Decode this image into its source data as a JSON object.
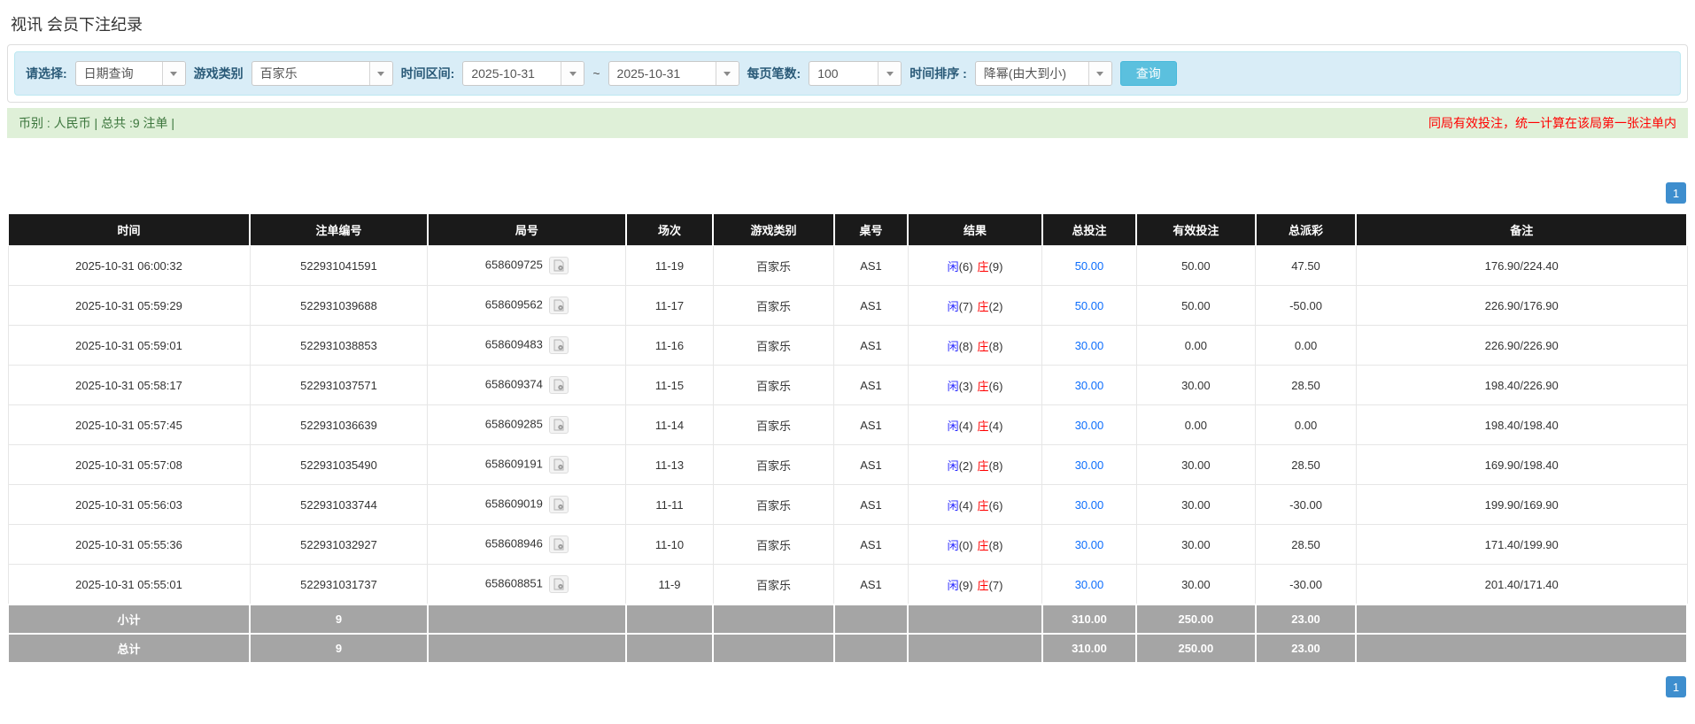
{
  "page": {
    "title": "视讯 会员下注纪录"
  },
  "filters": {
    "select_label": "请选择:",
    "select_value": "日期查询",
    "game_type_label": "游戏类别",
    "game_type_value": "百家乐",
    "date_range_label": "时间区间:",
    "date_from": "2025-10-31",
    "range_separator": "~",
    "date_to": "2025-10-31",
    "page_size_label": "每页笔数:",
    "page_size_value": "100",
    "sort_label": "时间排序 :",
    "sort_value": "降幂(由大到小)",
    "search_button": "查询"
  },
  "summary": {
    "left": "币别 : 人民币 | 总共 :9 注单 |",
    "right": "同局有效投注，统一计算在该局第一张注单内"
  },
  "pagination": {
    "page": "1"
  },
  "table": {
    "headers": [
      "时间",
      "注单编号",
      "局号",
      "场次",
      "游戏类别",
      "桌号",
      "结果",
      "总投注",
      "有效投注",
      "总派彩",
      "备注"
    ],
    "rows": [
      {
        "time": "2025-10-31 06:00:32",
        "bet_id": "522931041591",
        "round": "658609725",
        "session": "11-19",
        "game": "百家乐",
        "table_no": "AS1",
        "player": "闲",
        "player_num": "(6)",
        "banker": "庄",
        "banker_num": "(9)",
        "total_bet": "50.00",
        "valid_bet": "50.00",
        "payout": "47.50",
        "remark": "176.90/224.40"
      },
      {
        "time": "2025-10-31 05:59:29",
        "bet_id": "522931039688",
        "round": "658609562",
        "session": "11-17",
        "game": "百家乐",
        "table_no": "AS1",
        "player": "闲",
        "player_num": "(7)",
        "banker": "庄",
        "banker_num": "(2)",
        "total_bet": "50.00",
        "valid_bet": "50.00",
        "payout": "-50.00",
        "remark": "226.90/176.90"
      },
      {
        "time": "2025-10-31 05:59:01",
        "bet_id": "522931038853",
        "round": "658609483",
        "session": "11-16",
        "game": "百家乐",
        "table_no": "AS1",
        "player": "闲",
        "player_num": "(8)",
        "banker": "庄",
        "banker_num": "(8)",
        "total_bet": "30.00",
        "valid_bet": "0.00",
        "payout": "0.00",
        "remark": "226.90/226.90"
      },
      {
        "time": "2025-10-31 05:58:17",
        "bet_id": "522931037571",
        "round": "658609374",
        "session": "11-15",
        "game": "百家乐",
        "table_no": "AS1",
        "player": "闲",
        "player_num": "(3)",
        "banker": "庄",
        "banker_num": "(6)",
        "total_bet": "30.00",
        "valid_bet": "30.00",
        "payout": "28.50",
        "remark": "198.40/226.90"
      },
      {
        "time": "2025-10-31 05:57:45",
        "bet_id": "522931036639",
        "round": "658609285",
        "session": "11-14",
        "game": "百家乐",
        "table_no": "AS1",
        "player": "闲",
        "player_num": "(4)",
        "banker": "庄",
        "banker_num": "(4)",
        "total_bet": "30.00",
        "valid_bet": "0.00",
        "payout": "0.00",
        "remark": "198.40/198.40"
      },
      {
        "time": "2025-10-31 05:57:08",
        "bet_id": "522931035490",
        "round": "658609191",
        "session": "11-13",
        "game": "百家乐",
        "table_no": "AS1",
        "player": "闲",
        "player_num": "(2)",
        "banker": "庄",
        "banker_num": "(8)",
        "total_bet": "30.00",
        "valid_bet": "30.00",
        "payout": "28.50",
        "remark": "169.90/198.40"
      },
      {
        "time": "2025-10-31 05:56:03",
        "bet_id": "522931033744",
        "round": "658609019",
        "session": "11-11",
        "game": "百家乐",
        "table_no": "AS1",
        "player": "闲",
        "player_num": "(4)",
        "banker": "庄",
        "banker_num": "(6)",
        "total_bet": "30.00",
        "valid_bet": "30.00",
        "payout": "-30.00",
        "remark": "199.90/169.90"
      },
      {
        "time": "2025-10-31 05:55:36",
        "bet_id": "522931032927",
        "round": "658608946",
        "session": "11-10",
        "game": "百家乐",
        "table_no": "AS1",
        "player": "闲",
        "player_num": "(0)",
        "banker": "庄",
        "banker_num": "(8)",
        "total_bet": "30.00",
        "valid_bet": "30.00",
        "payout": "28.50",
        "remark": "171.40/199.90"
      },
      {
        "time": "2025-10-31 05:55:01",
        "bet_id": "522931031737",
        "round": "658608851",
        "session": "11-9",
        "game": "百家乐",
        "table_no": "AS1",
        "player": "闲",
        "player_num": "(9)",
        "banker": "庄",
        "banker_num": "(7)",
        "total_bet": "30.00",
        "valid_bet": "30.00",
        "payout": "-30.00",
        "remark": "201.40/171.40"
      }
    ],
    "subtotal": {
      "label": "小计",
      "count": "9",
      "total_bet": "310.00",
      "valid_bet": "250.00",
      "payout": "23.00"
    },
    "total": {
      "label": "总计",
      "count": "9",
      "total_bet": "310.00",
      "valid_bet": "250.00",
      "payout": "23.00"
    }
  },
  "colors": {
    "filter_bar_bg": "#d9edf7",
    "filter_bar_border": "#bce8f1",
    "search_button_bg": "#5bc0de",
    "summary_bg": "#dff0d8",
    "summary_text": "#3c763d",
    "notice_red": "#ff0000",
    "table_header_bg": "#1a1a1a",
    "footer_row_bg": "#a5a5a5",
    "link_blue": "#0d6efd",
    "player_blue": "#2929ff",
    "banker_red": "#ff0000",
    "negative_red": "#ff0000",
    "pagination_blue": "#3e8ece"
  }
}
